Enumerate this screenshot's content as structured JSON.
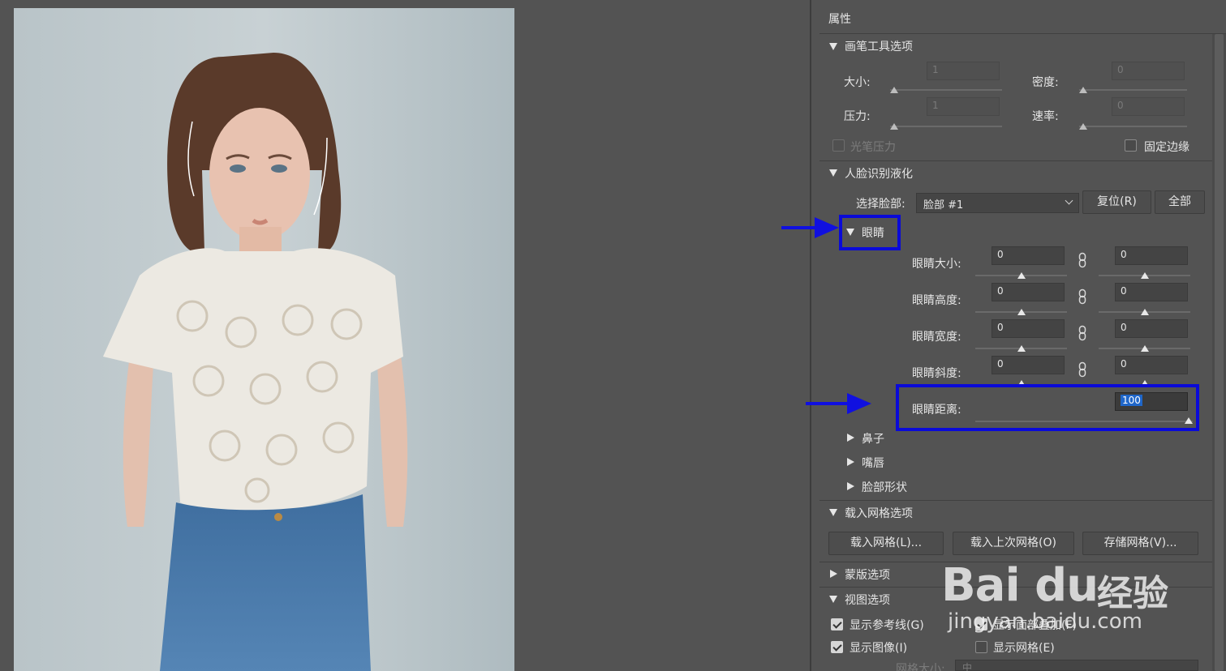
{
  "panel": {
    "title": "属性",
    "brush_section": {
      "title": "画笔工具选项",
      "size_label": "大小:",
      "size_value": "1",
      "density_label": "密度:",
      "density_value": "0",
      "pressure_label": "压力:",
      "pressure_value": "1",
      "rate_label": "速率:",
      "rate_value": "0",
      "stylus_pressure": "光笔压力",
      "pin_edges": "固定边缘"
    },
    "face_section": {
      "title": "人脸识别液化",
      "select_face_label": "选择脸部:",
      "select_face_value": "脸部 #1",
      "reset_button": "复位(R)",
      "all_button": "全部",
      "eyes": {
        "title": "眼睛",
        "eye_size": {
          "label": "眼睛大小:",
          "left": "0",
          "right": "0"
        },
        "eye_height": {
          "label": "眼睛高度:",
          "left": "0",
          "right": "0"
        },
        "eye_width": {
          "label": "眼睛宽度:",
          "left": "0",
          "right": "0"
        },
        "eye_tilt": {
          "label": "眼睛斜度:",
          "left": "0",
          "right": "0"
        },
        "eye_distance": {
          "label": "眼睛距离:",
          "value": "100"
        }
      },
      "nose": "鼻子",
      "mouth": "嘴唇",
      "face_shape": "脸部形状"
    },
    "mesh_section": {
      "title": "载入网格选项",
      "load_mesh": "载入网格(L)...",
      "load_last_mesh": "载入上次网格(O)",
      "save_mesh": "存储网格(V)..."
    },
    "mask_section": {
      "title": "蒙版选项"
    },
    "view_section": {
      "title": "视图选项",
      "show_guides": "显示参考线(G)",
      "show_face_overlay": "显示面部叠加(F)",
      "show_image": "显示图像(I)",
      "show_mesh": "显示网格(E)",
      "mesh_size_label": "网格大小:",
      "mesh_size_value": "中"
    }
  },
  "watermark": {
    "logo": "Bai du",
    "brand_cn": "经验",
    "url": "jingyan.baidu.com"
  },
  "colors": {
    "annotation": "#0a0ad8",
    "selection": "#1f66c9",
    "panel_bg": "#535353"
  }
}
